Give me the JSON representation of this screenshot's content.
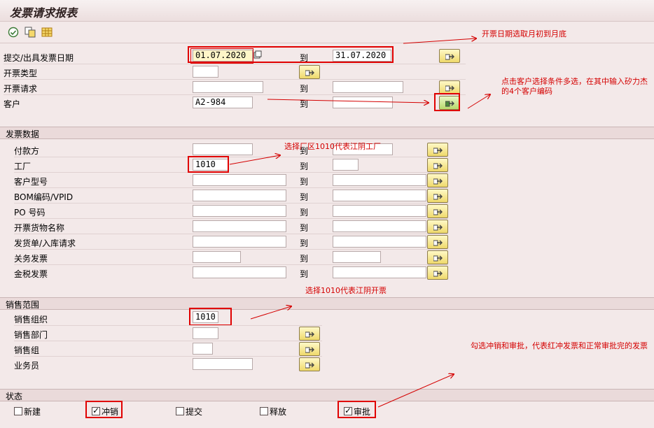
{
  "title": "发票请求报表",
  "toolbar": {
    "icons": [
      "execute-icon",
      "copy-variant-icon",
      "table-icon"
    ]
  },
  "selection": {
    "rows": [
      {
        "label": "提交/出具发票日期",
        "low": "01.07.2020",
        "to": "到",
        "high": "31.07.2020"
      },
      {
        "label": "开票类型",
        "low": "",
        "to": "",
        "high": ""
      },
      {
        "label": "开票请求",
        "low": "",
        "to": "到",
        "high": ""
      },
      {
        "label": "客户",
        "low": "A2-984",
        "to": "到",
        "high": ""
      }
    ]
  },
  "invoice_data": {
    "title": "发票数据",
    "rows": [
      {
        "label": "付款方",
        "low": "",
        "to": "到",
        "high": ""
      },
      {
        "label": "工厂",
        "low": "1010",
        "to": "到",
        "high": ""
      },
      {
        "label": "客户型号",
        "low": "",
        "to": "到",
        "high": ""
      },
      {
        "label": "BOM编码/VPID",
        "low": "",
        "to": "到",
        "high": ""
      },
      {
        "label": "PO 号码",
        "low": "",
        "to": "到",
        "high": ""
      },
      {
        "label": "开票货物名称",
        "low": "",
        "to": "到",
        "high": ""
      },
      {
        "label": "发货单/入库请求",
        "low": "",
        "to": "到",
        "high": ""
      },
      {
        "label": "关务发票",
        "low": "",
        "to": "到",
        "high": ""
      },
      {
        "label": "金税发票",
        "low": "",
        "to": "到",
        "high": ""
      }
    ]
  },
  "sales_area": {
    "title": "销售范围",
    "rows": [
      {
        "label": "销售组织",
        "low": "1010"
      },
      {
        "label": "销售部门",
        "low": ""
      },
      {
        "label": "销售组",
        "low": ""
      },
      {
        "label": "业务员",
        "low": ""
      }
    ]
  },
  "status": {
    "title": "状态",
    "items": [
      {
        "label": "新建",
        "checked": false
      },
      {
        "label": "冲销",
        "checked": true
      },
      {
        "label": "提交",
        "checked": false
      },
      {
        "label": "释放",
        "checked": false
      },
      {
        "label": "审批",
        "checked": true
      }
    ]
  },
  "annotations": {
    "a1": "开票日期选取月初到月底",
    "a2": "点击客户选择条件多选，在其中输入矽力杰的4个客户编码",
    "a3": "选择厂区1010代表江阴工厂",
    "a4": "选择1010代表江阴开票",
    "a5": "勾选冲销和审批，代表红冲发票和正常审批完的发票"
  },
  "colors": {
    "annotation": "#d40000",
    "background": "#f3e9e9"
  }
}
